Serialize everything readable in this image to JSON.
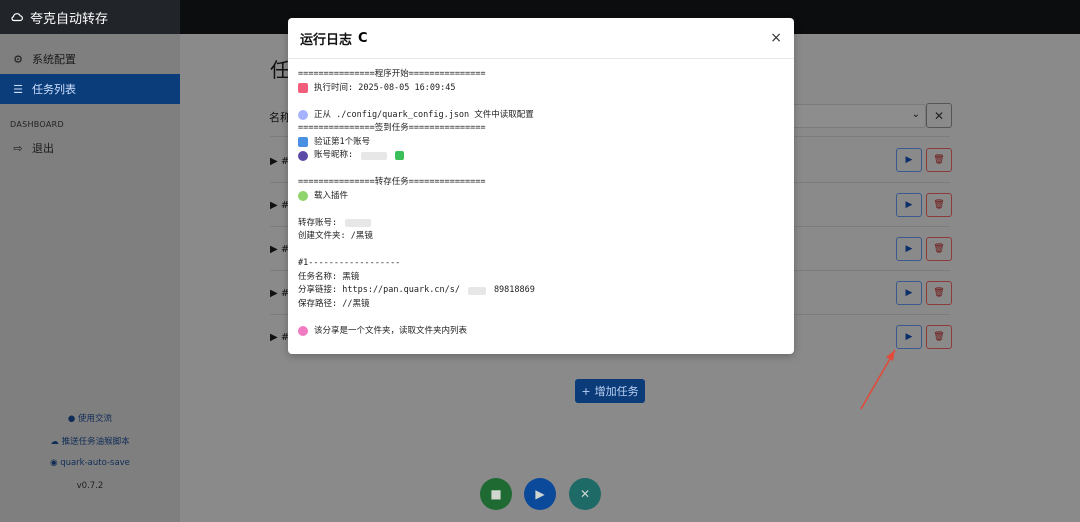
{
  "brand": {
    "title": "夸克自动转存"
  },
  "sidebar": {
    "items": [
      {
        "label": "系统配置"
      },
      {
        "label": "任务列表"
      }
    ],
    "section": "DASHBOARD",
    "logout": "退出",
    "footer": {
      "links": [
        {
          "label": "使用交流"
        },
        {
          "label": "推送任务油猴脚本"
        },
        {
          "label": "quark-auto-save"
        }
      ],
      "version": "v0.7.2"
    }
  },
  "main": {
    "title": "任",
    "filter_label": "名称",
    "row_prefix": "#",
    "add_task": "增加任务"
  },
  "modal": {
    "title": "运行日志",
    "spinner_glyph": "C",
    "close_glyph": "×",
    "lines": [
      "===============程序开始===============",
      "执行时间: 2025-08-05 16:09:45",
      "",
      "正从 ./config/quark_config.json 文件中读取配置",
      "===============签到任务===============",
      "验证第1个账号",
      "账号昵称:",
      "",
      "===============转存任务===============",
      "载入插件",
      "",
      "转存账号:",
      "创建文件夹: /黑镜",
      "",
      "#1------------------",
      "任务名称: 黑镜",
      "分享链接: https://pan.quark.cn/s/",
      "保存路径: //黑镜",
      "",
      "该分享是一个文件夹，读取文件夹内列表"
    ],
    "share_suffix": "89818869"
  },
  "colors": {
    "accent": "#0b3b78",
    "save": "#1f7a3a",
    "run": "#0b4fa6",
    "cancel": "#1f6f6a"
  }
}
